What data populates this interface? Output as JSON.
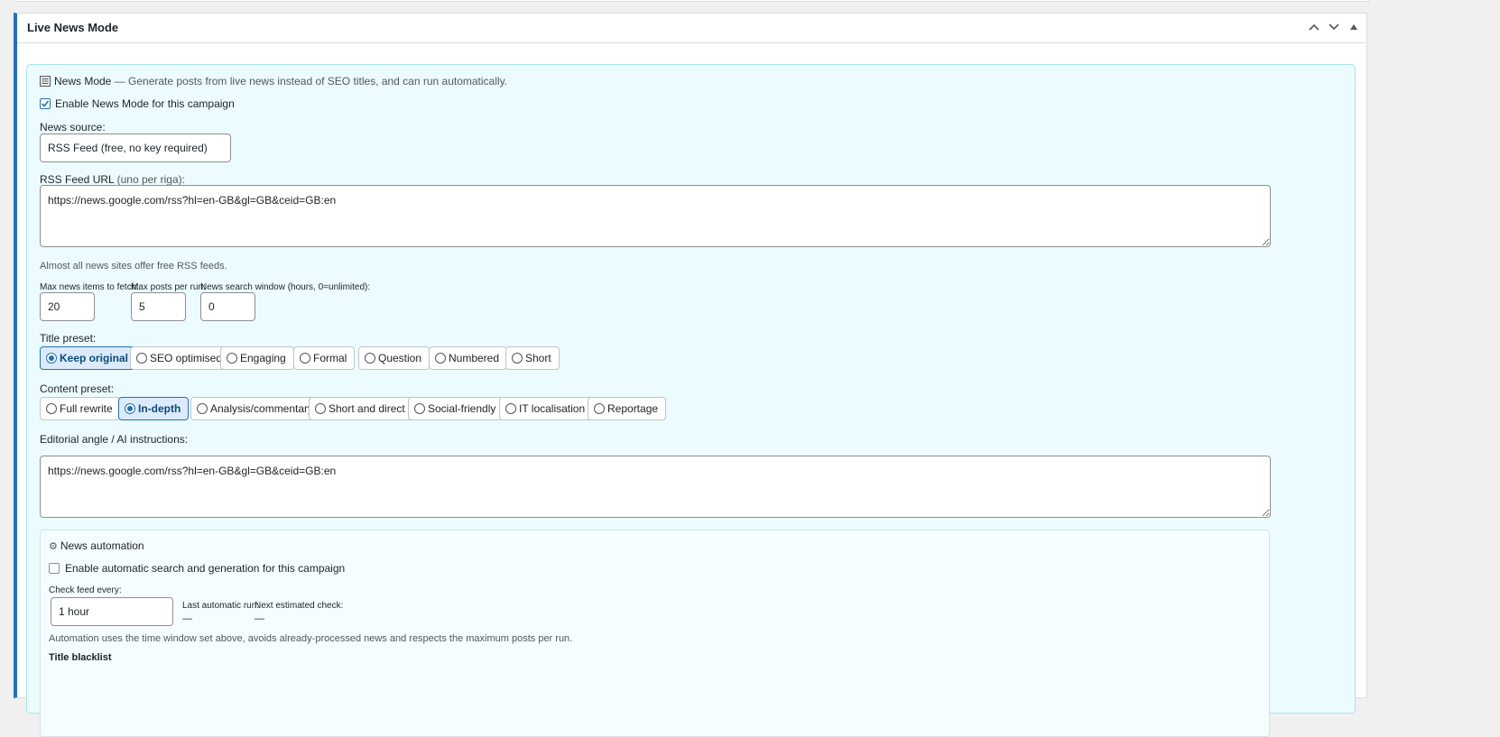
{
  "metabox": {
    "title": "Live News Mode"
  },
  "news_mode": {
    "intro_title": "News Mode",
    "intro_text": " — Generate posts from live news instead of SEO titles, and can run automatically.",
    "enable_label": "Enable News Mode for this campaign",
    "enable_checked": true,
    "source_label": "News source:",
    "source_value": "RSS Feed (free, no key required)",
    "rss_label": "RSS Feed URL",
    "rss_label_hint": " (uno per riga):",
    "rss_value": "https://news.google.com/rss?hl=en-GB&gl=GB&ceid=GB:en",
    "rss_help": "Almost all news sites offer free RSS feeds.",
    "max_items_label": "Max news items to fetch:",
    "max_items_value": "20",
    "max_posts_label": "Max posts per run:",
    "max_posts_value": "5",
    "window_label": "News search window (hours, 0=unlimited):",
    "window_value": "0",
    "title_preset_label": "Title preset:",
    "title_presets": [
      {
        "label": "Keep original",
        "active": true
      },
      {
        "label": "SEO optimised",
        "active": false
      },
      {
        "label": "Engaging",
        "active": false
      },
      {
        "label": "Formal",
        "active": false
      },
      {
        "label": "Question",
        "active": false
      },
      {
        "label": "Numbered",
        "active": false
      },
      {
        "label": "Short",
        "active": false
      }
    ],
    "content_preset_label": "Content preset:",
    "content_presets": [
      {
        "label": "Full rewrite",
        "active": false
      },
      {
        "label": "In-depth",
        "active": true
      },
      {
        "label": "Analysis/commentary",
        "active": false
      },
      {
        "label": "Short and direct",
        "active": false
      },
      {
        "label": "Social-friendly",
        "active": false
      },
      {
        "label": "IT localisation",
        "active": false
      },
      {
        "label": "Reportage",
        "active": false
      }
    ],
    "angle_label": "Editorial angle / AI instructions:",
    "angle_value": "https://news.google.com/rss?hl=en-GB&gl=GB&ceid=GB:en"
  },
  "automation": {
    "title": "News automation",
    "icon": "gear-icon",
    "enable_label": "Enable automatic search and generation for this campaign",
    "enable_checked": false,
    "check_label": "Check feed every:",
    "check_value": "1 hour",
    "last_run_label": "Last automatic run:",
    "last_run_value": "—",
    "next_check_label": "Next estimated check:",
    "next_check_value": "—",
    "note": "Automation uses the time window set above, avoids already-processed news and respects the maximum posts per run.",
    "blacklist_label": "Title blacklist"
  },
  "colors": {
    "accent": "#2271b1",
    "panel_bg": "#ecfcfe",
    "panel_border": "#a8e4ee"
  }
}
